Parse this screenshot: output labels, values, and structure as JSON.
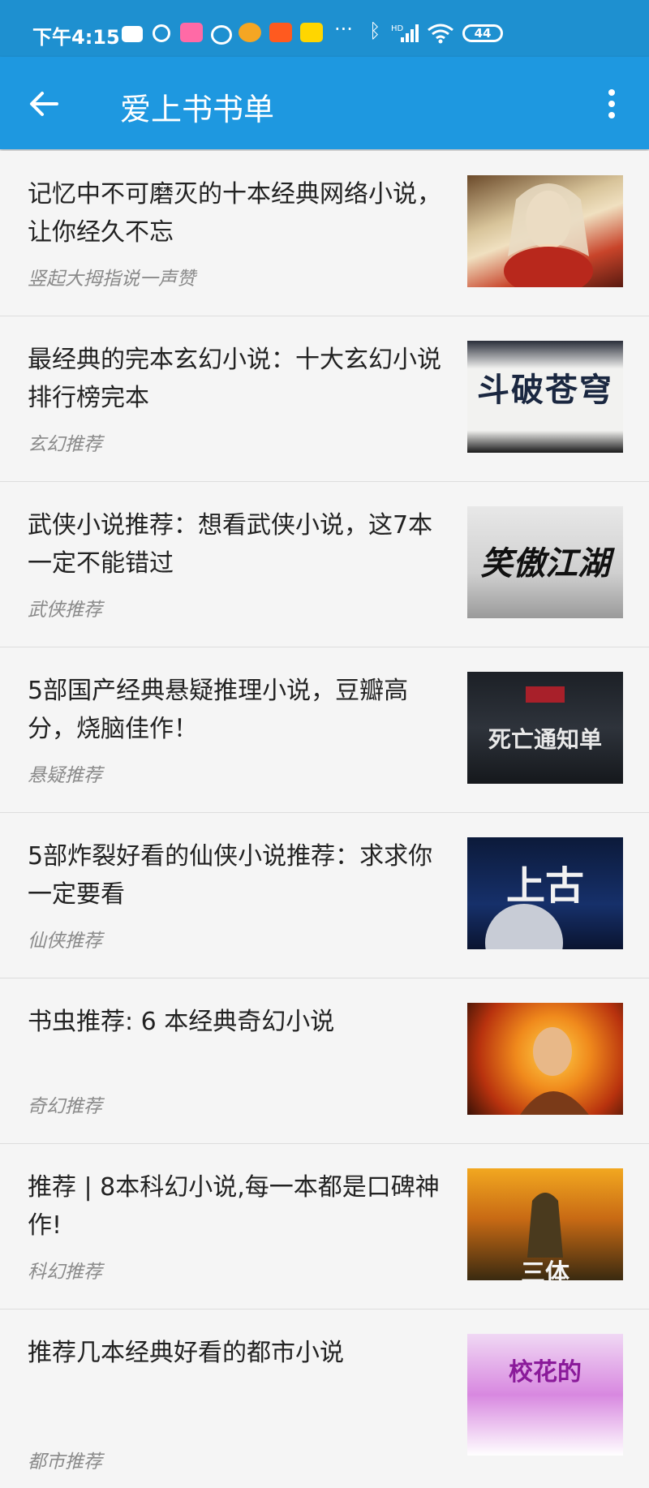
{
  "status_bar": {
    "time": "下午4:15",
    "battery": "44",
    "icons": [
      "message-icon",
      "location-icon",
      "bilibili-icon",
      "weibo-icon",
      "weibo-icon",
      "taobao-icon",
      "xianyu-icon",
      "more-dots-icon",
      "bluetooth-icon",
      "hd-signal-icon",
      "wifi-icon",
      "battery-icon"
    ]
  },
  "app_bar": {
    "title": "爱上书书单",
    "back_icon": "arrow-left-icon",
    "menu_icon": "more-vertical-icon"
  },
  "colors": {
    "status_bar": "#1e90d0",
    "app_bar": "#1e98e0",
    "background": "#f2f2f2",
    "title_text": "#222222",
    "tag_text": "#8a8a8a"
  },
  "items": [
    {
      "title": "记忆中不可磨灭的十本经典网络小说，让你经久不忘",
      "tag": "竖起大拇指说一声赞"
    },
    {
      "title": "最经典的完本玄幻小说：十大玄幻小说排行榜完本",
      "tag": "玄幻推荐",
      "cover_text": "斗破苍穹"
    },
    {
      "title": "武侠小说推荐：想看武侠小说，这7本一定不能错过",
      "tag": "武侠推荐",
      "cover_text": "笑傲江湖"
    },
    {
      "title": "5部国产经典悬疑推理小说，豆瓣高分，烧脑佳作！",
      "tag": "悬疑推荐",
      "cover_text": "死亡通知单"
    },
    {
      "title": "5部炸裂好看的仙侠小说推荐：求求你一定要看",
      "tag": "仙侠推荐",
      "cover_text": "上古"
    },
    {
      "title": "书虫推荐: 6 本经典奇幻小说",
      "tag": "奇幻推荐"
    },
    {
      "title": "推荐 | 8本科幻小说,每一本都是口碑神作!",
      "tag": "科幻推荐",
      "cover_text": "三体"
    },
    {
      "title": "推荐几本经典好看的都市小说",
      "tag": "都市推荐",
      "cover_text": "校花的"
    }
  ]
}
